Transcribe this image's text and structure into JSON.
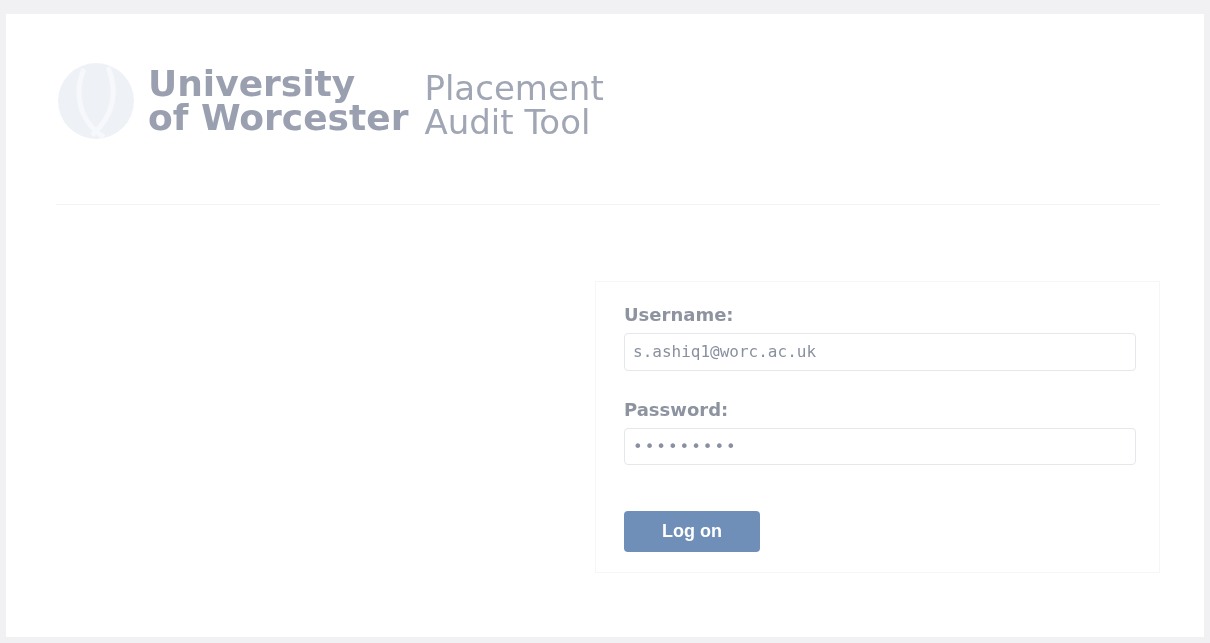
{
  "header": {
    "logo_line_1": "University",
    "logo_line_2": "of Worcester",
    "app_title_line_1": "Placement",
    "app_title_line_2": "Audit Tool"
  },
  "login_form": {
    "fields": [
      {
        "label": "Username:",
        "value": "s.ashiq1@worc.ac.uk",
        "kind": "text"
      },
      {
        "label": "Password:",
        "value": "•••••••••",
        "kind": "password"
      }
    ],
    "button": "Log on"
  }
}
